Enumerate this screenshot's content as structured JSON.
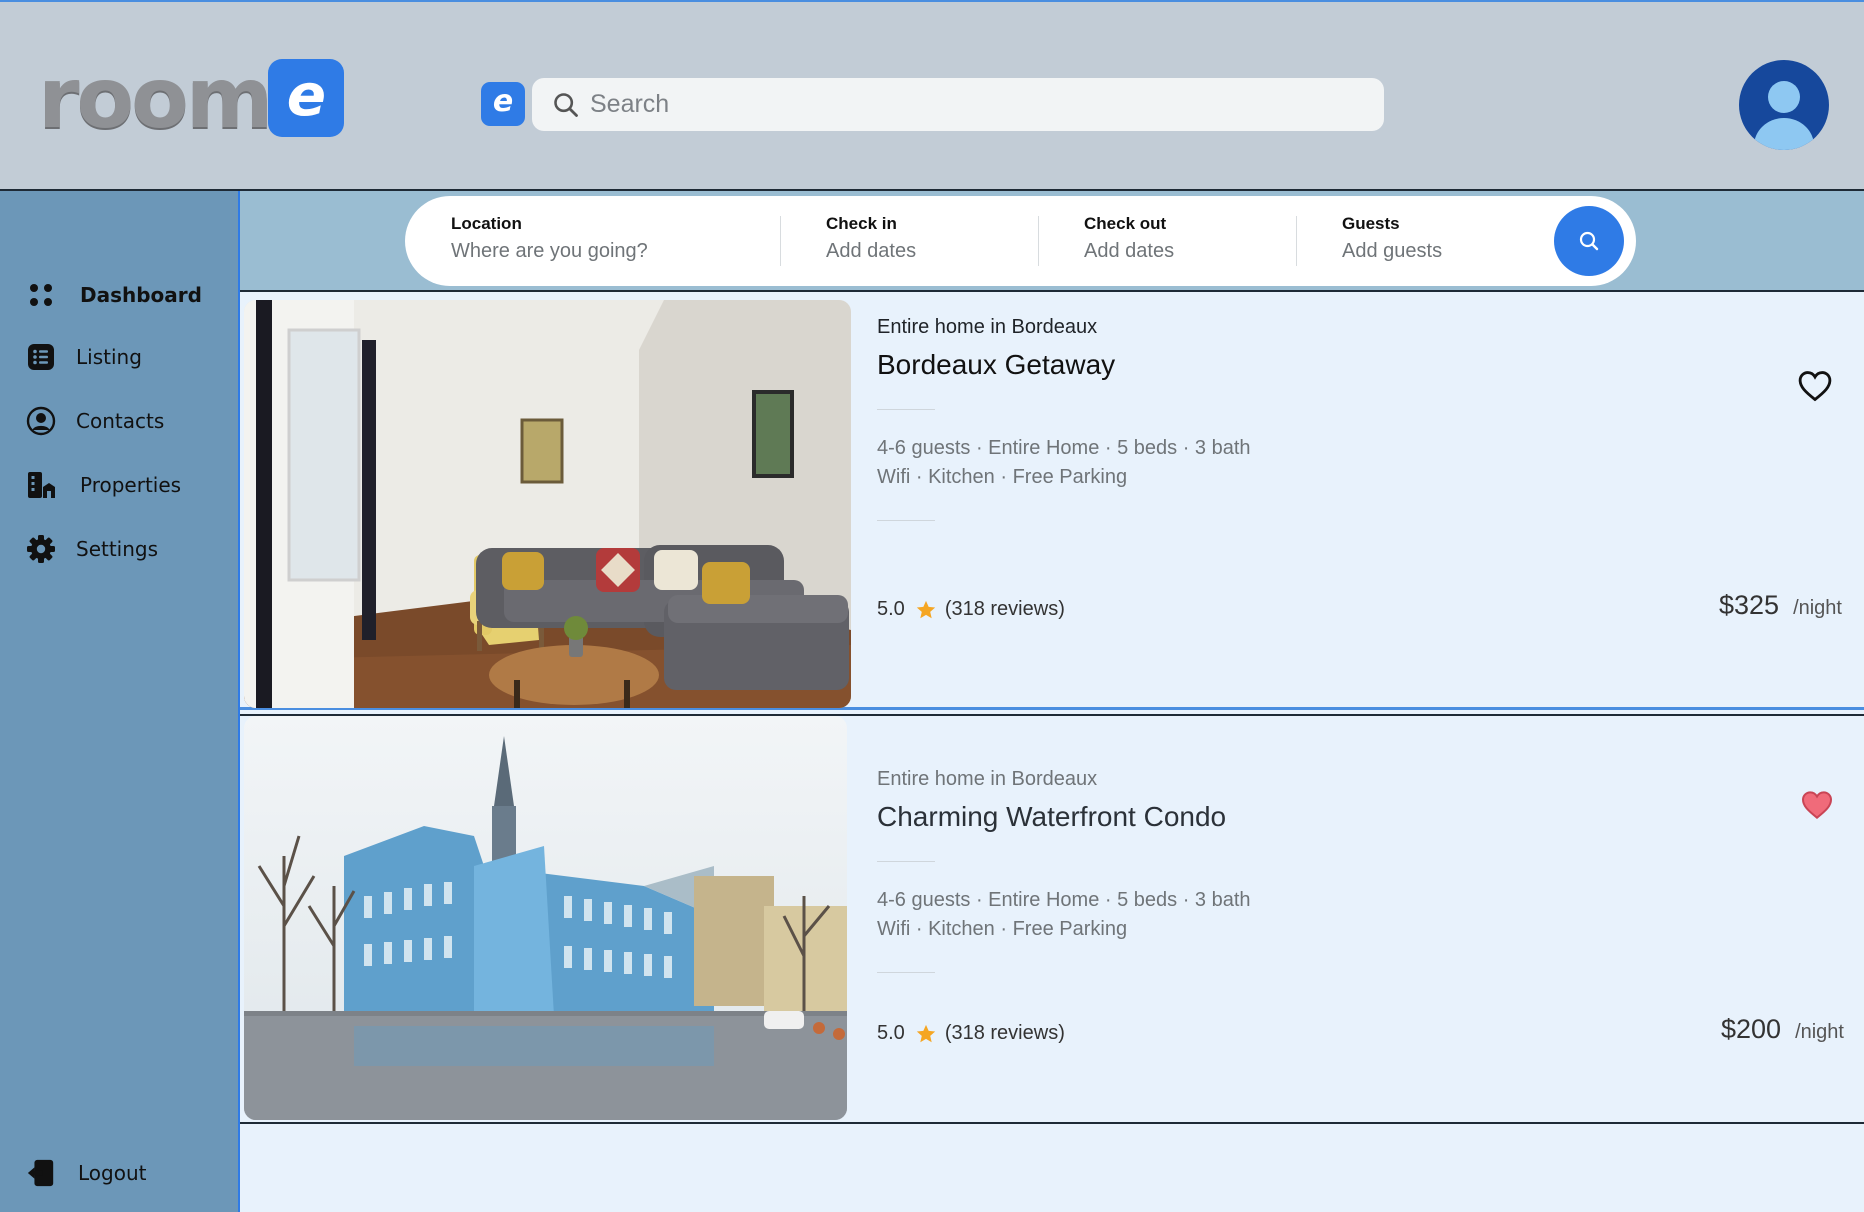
{
  "app": {
    "logo_text": "room",
    "logo_badge": "e",
    "mini_badge": "e"
  },
  "header": {
    "search_placeholder": "Search"
  },
  "sidebar": {
    "items": [
      {
        "label": "Dashboard",
        "icon": "dots-grid-icon",
        "active": true
      },
      {
        "label": "Listing",
        "icon": "list-icon",
        "active": false
      },
      {
        "label": "Contacts",
        "icon": "user-circle-icon",
        "active": false
      },
      {
        "label": "Properties",
        "icon": "buildings-icon",
        "active": false
      },
      {
        "label": "Settings",
        "icon": "gear-icon",
        "active": false
      }
    ],
    "logout": {
      "label": "Logout",
      "icon": "logout-icon"
    }
  },
  "booking": {
    "location": {
      "label": "Location",
      "placeholder": "Where are you going?"
    },
    "checkin": {
      "label": "Check in",
      "placeholder": "Add dates"
    },
    "checkout": {
      "label": "Check out",
      "placeholder": "Add dates"
    },
    "guests": {
      "label": "Guests",
      "placeholder": "Add guests"
    }
  },
  "listings": [
    {
      "type": "Entire home in Bordeaux",
      "title": "Bordeaux Getaway",
      "features_1": "4-6 guests · Entire Home · 5 beds · 3 bath",
      "features_2": "Wifi · Kitchen · Free Parking",
      "rating": "5.0",
      "reviews": "(318 reviews)",
      "price": "$325",
      "per": "/night",
      "favorited": false,
      "image": "living-room-photo"
    },
    {
      "type": "Entire home in Bordeaux",
      "title": "Charming Waterfront Condo",
      "features_1": "4-6 guests · Entire Home · 5 beds · 3 bath",
      "features_2": "Wifi · Kitchen · Free Parking",
      "rating": "5.0",
      "reviews": "(318 reviews)",
      "price": "$200",
      "per": "/night",
      "favorited": true,
      "image": "blue-building-photo"
    }
  ],
  "colors": {
    "accent": "#2f7be6",
    "sidebar": "#6c97b8",
    "header": "#c2ccd6",
    "star": "#f5a623",
    "heart_active": "#f06b7a"
  }
}
